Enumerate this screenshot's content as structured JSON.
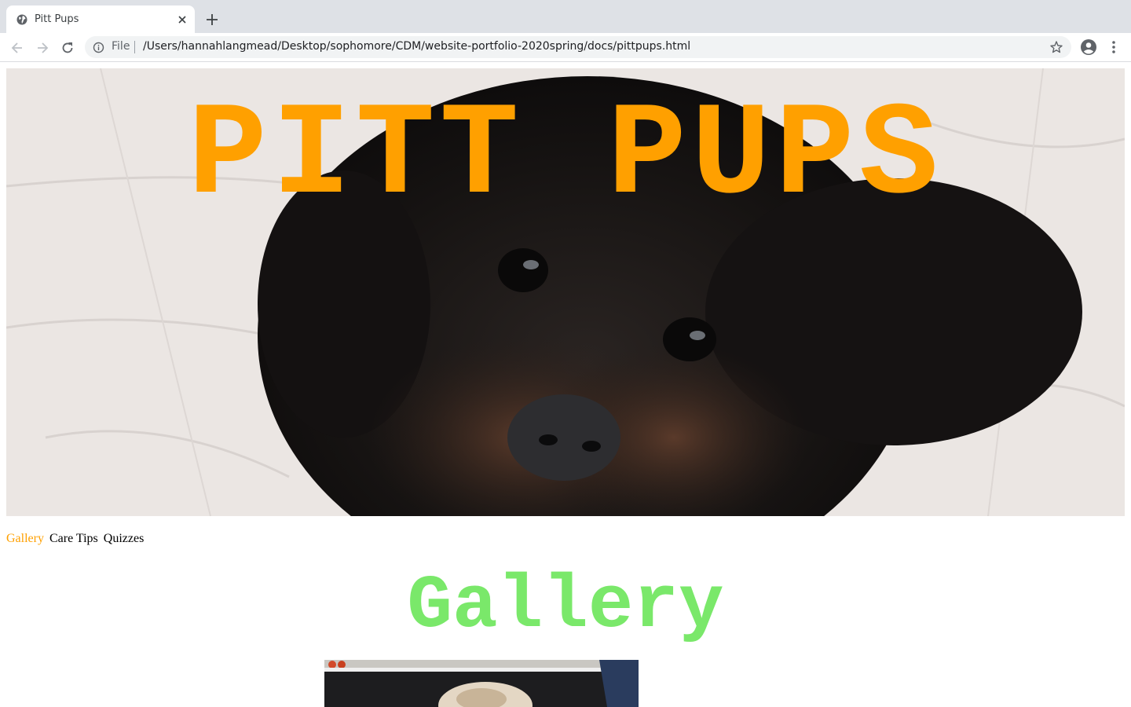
{
  "browser": {
    "tab_title": "Pitt Pups",
    "address_scheme": "File",
    "address_path": "/Users/hannahlangmead/Desktop/sophomore/CDM/website-portfolio-2020spring/docs/pittpups.html",
    "icons": [
      "globe-icon",
      "close-icon",
      "plus-icon",
      "back-icon",
      "forward-icon",
      "reload-icon",
      "info-icon",
      "star-icon",
      "profile-icon",
      "menu-icon"
    ]
  },
  "page": {
    "hero_title": "PITT PUPS",
    "nav": {
      "gallery": "Gallery",
      "care_tips": "Care Tips",
      "quizzes": "Quizzes"
    },
    "section_title": "Gallery"
  },
  "colors": {
    "accent_orange": "#ffa000",
    "title_green": "#7ae86a",
    "tabstrip": "#dee1e6"
  }
}
